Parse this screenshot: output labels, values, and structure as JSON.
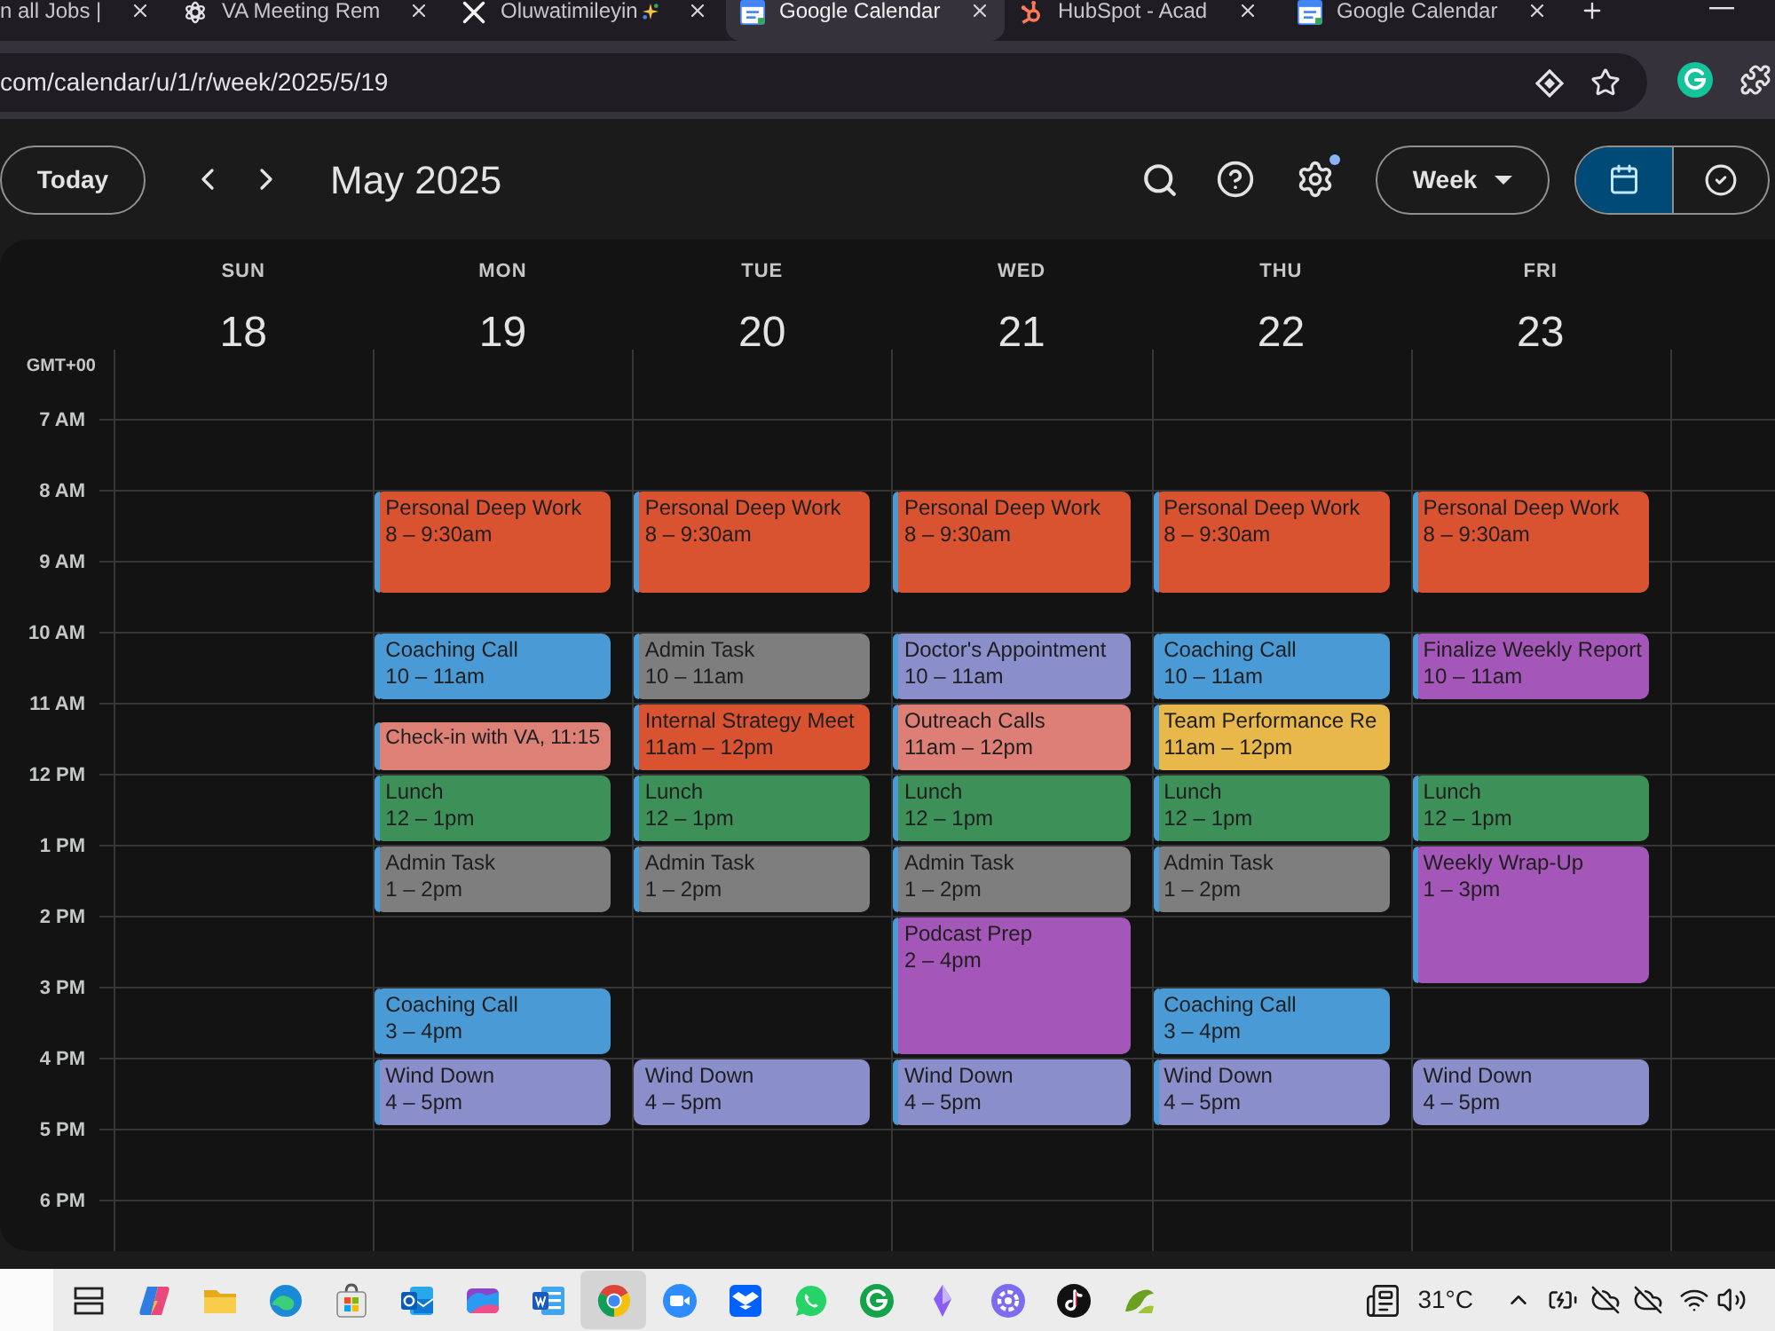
{
  "browser": {
    "tabs": [
      {
        "title": "n all Jobs |",
        "selected": false
      },
      {
        "title": "VA Meeting Rem",
        "selected": false
      },
      {
        "title": "Oluwatimileyin",
        "selected": false
      },
      {
        "title": "Google Calendar",
        "selected": true
      },
      {
        "title": "HubSpot - Acad",
        "selected": false
      },
      {
        "title": "Google Calendar",
        "selected": false
      }
    ],
    "address": "com/calendar/u/1/r/week/2025/5/19"
  },
  "toolbar": {
    "today": "Today",
    "title": "May 2025",
    "settings_dot": true,
    "view": "Week",
    "view_toggle": [
      {
        "selected": true
      },
      {
        "selected": false
      }
    ]
  },
  "calendar": {
    "timezone": "GMT+00",
    "hours": [
      "7 AM",
      "8 AM",
      "9 AM",
      "10 AM",
      "11 AM",
      "12 PM",
      "1 PM",
      "2 PM",
      "3 PM",
      "4 PM",
      "5 PM",
      "6 PM"
    ],
    "days": [
      {
        "name": "SUN",
        "date": "18"
      },
      {
        "name": "MON",
        "date": "19",
        "events": [
          {
            "kind": "standard",
            "title": "Personal Deep Work",
            "time": "8 – 9:30am",
            "color": "#da5331",
            "stripe": true
          },
          {
            "kind": "standard",
            "title": "Coaching Call",
            "time": "10 – 11am",
            "color": "#4a9ad6",
            "stripe": true
          },
          {
            "kind": "compact",
            "title": "Check-in with VA,",
            "time": "11:15",
            "color": "#dd8177",
            "stripe": true
          },
          {
            "kind": "standard",
            "title": "Lunch",
            "time": "12 – 1pm",
            "color": "#3e9059",
            "stripe": true
          },
          {
            "kind": "standard",
            "title": "Admin Task",
            "time": "1 – 2pm",
            "color": "#7e7e7e",
            "stripe": true
          },
          {
            "kind": "standard",
            "title": "Coaching Call",
            "time": "3 – 4pm",
            "color": "#4a9ad6",
            "stripe": true
          },
          {
            "kind": "standard",
            "title": "Wind Down",
            "time": "4 – 5pm",
            "color": "#8a8fcb",
            "stripe": true
          }
        ]
      },
      {
        "name": "TUE",
        "date": "20",
        "events": [
          {
            "kind": "standard",
            "title": "Personal Deep Work",
            "time": "8 – 9:30am",
            "color": "#da5331",
            "stripe": true
          },
          {
            "kind": "standard",
            "title": "Admin Task",
            "time": "10 – 11am",
            "color": "#7e7e7e",
            "stripe": true
          },
          {
            "kind": "standard",
            "title": "Internal Strategy Meet",
            "time": "11am – 12pm",
            "color": "#da5331",
            "stripe": true
          },
          {
            "kind": "standard",
            "title": "Lunch",
            "time": "12 – 1pm",
            "color": "#3e9059",
            "stripe": true
          },
          {
            "kind": "standard",
            "title": "Admin Task",
            "time": "1 – 2pm",
            "color": "#7e7e7e",
            "stripe": true
          },
          {
            "kind": "standard",
            "title": "Wind Down",
            "time": "4 – 5pm",
            "color": "#8a8fcb",
            "stripe": false
          }
        ]
      },
      {
        "name": "WED",
        "date": "21",
        "events": [
          {
            "kind": "standard",
            "title": "Personal Deep Work",
            "time": "8 – 9:30am",
            "color": "#da5331",
            "stripe": true
          },
          {
            "kind": "standard",
            "title": "Doctor's Appointment",
            "time": "10 – 11am",
            "color": "#8a8ecb",
            "stripe": true
          },
          {
            "kind": "standard",
            "title": "Outreach Calls",
            "time": "11am – 12pm",
            "color": "#dd7f76",
            "stripe": true
          },
          {
            "kind": "standard",
            "title": "Lunch",
            "time": "12 – 1pm",
            "color": "#3e9059",
            "stripe": true
          },
          {
            "kind": "standard",
            "title": "Admin Task",
            "time": "1 – 2pm",
            "color": "#7e7e7e",
            "stripe": true
          },
          {
            "kind": "standard",
            "title": "Podcast Prep",
            "time": "2 – 4pm",
            "color": "#a556b9",
            "stripe": true
          },
          {
            "kind": "standard",
            "title": "Wind Down",
            "time": "4 – 5pm",
            "color": "#8a8fcb",
            "stripe": true
          }
        ]
      },
      {
        "name": "THU",
        "date": "22",
        "events": [
          {
            "kind": "standard",
            "title": "Personal Deep Work",
            "time": "8 – 9:30am",
            "color": "#da5331",
            "stripe": true
          },
          {
            "kind": "standard",
            "title": "Coaching Call",
            "time": "10 – 11am",
            "color": "#4a9ad6",
            "stripe": true
          },
          {
            "kind": "standard",
            "title": "Team Performance Re",
            "time": "11am – 12pm",
            "color": "#e9b84b",
            "stripe": true
          },
          {
            "kind": "standard",
            "title": "Lunch",
            "time": "12 – 1pm",
            "color": "#3e9059",
            "stripe": true
          },
          {
            "kind": "standard",
            "title": "Admin Task",
            "time": "1 – 2pm",
            "color": "#7e7e7e",
            "stripe": true
          },
          {
            "kind": "standard",
            "title": "Coaching Call",
            "time": "3 – 4pm",
            "color": "#4a9ad6",
            "stripe": true
          },
          {
            "kind": "standard",
            "title": "Wind Down",
            "time": "4 – 5pm",
            "color": "#8a8fcb",
            "stripe": true
          }
        ]
      },
      {
        "name": "FRI",
        "date": "23",
        "events": [
          {
            "kind": "standard",
            "title": "Personal Deep Work",
            "time": "8 – 9:30am",
            "color": "#da5331",
            "stripe": true
          },
          {
            "kind": "standard",
            "title": "Finalize Weekly Report",
            "time": "10 – 11am",
            "color": "#a556b9",
            "stripe": true
          },
          {
            "kind": "standard",
            "title": "Lunch",
            "time": "12 – 1pm",
            "color": "#3e9059",
            "stripe": true
          },
          {
            "kind": "standard",
            "title": "Weekly Wrap-Up",
            "time": "1 – 3pm",
            "color": "#a556b9",
            "stripe": true
          },
          {
            "kind": "standard",
            "title": "Wind Down",
            "time": "4 – 5pm",
            "color": "#8a8fcb",
            "stripe": false
          }
        ]
      }
    ]
  },
  "taskbar": {
    "apps": [
      {
        "selected": false
      },
      {
        "selected": false
      },
      {
        "selected": false
      },
      {
        "selected": false
      },
      {
        "selected": false
      },
      {
        "selected": false
      },
      {
        "selected": false
      },
      {
        "selected": true
      },
      {
        "selected": false
      },
      {
        "selected": false
      },
      {
        "selected": false
      },
      {
        "selected": false
      },
      {
        "selected": false
      },
      {
        "selected": false
      },
      {
        "selected": false
      },
      {
        "selected": false
      }
    ],
    "weather": "31°C"
  }
}
